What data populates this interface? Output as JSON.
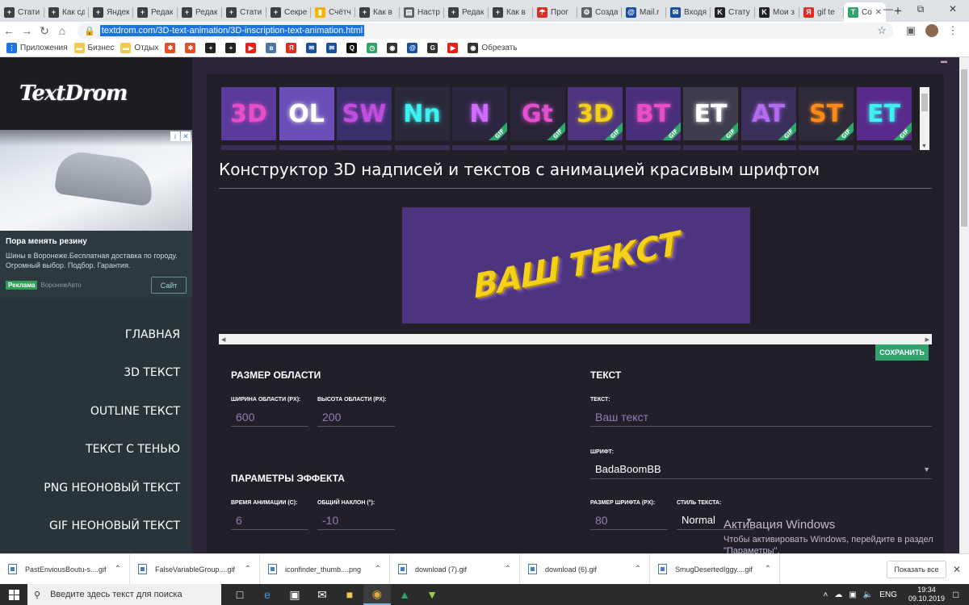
{
  "browser": {
    "tabs": [
      {
        "label": "Стати",
        "icon": "plus-icon",
        "color": "#3c4043"
      },
      {
        "label": "Как сд",
        "icon": "plus-icon",
        "color": "#3c4043"
      },
      {
        "label": "Яндек",
        "icon": "plus-icon",
        "color": "#3c4043"
      },
      {
        "label": "Редак",
        "icon": "plus-icon",
        "color": "#3c4043"
      },
      {
        "label": "Редак",
        "icon": "plus-icon",
        "color": "#3c4043"
      },
      {
        "label": "Стати",
        "icon": "plus-icon",
        "color": "#3c4043"
      },
      {
        "label": "Секре",
        "icon": "plus-icon",
        "color": "#3c4043"
      },
      {
        "label": "Счётч",
        "icon": "bar-icon",
        "color": "#f4b400"
      },
      {
        "label": "Как в",
        "icon": "plus-icon",
        "color": "#3c4043"
      },
      {
        "label": "Настр",
        "icon": "page-icon",
        "color": "#5f6368"
      },
      {
        "label": "Редак",
        "icon": "plus-icon",
        "color": "#3c4043"
      },
      {
        "label": "Как в",
        "icon": "plus-icon",
        "color": "#3c4043"
      },
      {
        "label": "Прог",
        "icon": "umbrella-icon",
        "color": "#d93025"
      },
      {
        "label": "Созда",
        "icon": "gear-icon",
        "color": "#5f6368"
      },
      {
        "label": "Mail.r",
        "icon": "at-icon",
        "color": "#1a4fa0"
      },
      {
        "label": "Входя",
        "icon": "mail-icon",
        "color": "#1a4fa0"
      },
      {
        "label": "Стату",
        "icon": "k-icon",
        "color": "#222"
      },
      {
        "label": "Мои з",
        "icon": "k-icon",
        "color": "#222"
      },
      {
        "label": "gif te",
        "icon": "yandex-icon",
        "color": "#d93025"
      },
      {
        "label": "Co",
        "icon": "td-icon",
        "color": "#2fa36b",
        "active": true
      }
    ],
    "new_tab": "+",
    "url": "textdrom.com/3D-text-animation/3D-inscription-text-animation.html",
    "bookmarks": [
      {
        "label": "Приложения",
        "icon": "apps-icon",
        "color": "#1a73e8"
      },
      {
        "label": "Бизнес",
        "icon": "folder-icon",
        "color": "#f2c94c"
      },
      {
        "label": "Отдых",
        "icon": "folder-icon",
        "color": "#f2c94c"
      },
      {
        "label": "",
        "icon": "joomla-icon",
        "color": "#e44d26"
      },
      {
        "label": "",
        "icon": "joomla-icon",
        "color": "#e44d26"
      },
      {
        "label": "",
        "icon": "plus-icon",
        "color": "#222"
      },
      {
        "label": "",
        "icon": "plus-icon",
        "color": "#222"
      },
      {
        "label": "",
        "icon": "youtube-icon",
        "color": "#e62117"
      },
      {
        "label": "",
        "icon": "vk-icon",
        "color": "#4a76a8"
      },
      {
        "label": "",
        "icon": "yandex-icon",
        "color": "#d93025"
      },
      {
        "label": "",
        "icon": "mail-icon",
        "color": "#1a4fa0"
      },
      {
        "label": "",
        "icon": "mail-icon",
        "color": "#1a4fa0"
      },
      {
        "label": "",
        "icon": "q-icon",
        "color": "#111"
      },
      {
        "label": "",
        "icon": "clock-icon",
        "color": "#2fa36b"
      },
      {
        "label": "",
        "icon": "chrome-icon",
        "color": "#333"
      },
      {
        "label": "",
        "icon": "at-icon",
        "color": "#1a4fa0"
      },
      {
        "label": "",
        "icon": "g-icon",
        "color": "#333"
      },
      {
        "label": "",
        "icon": "youtube-icon",
        "color": "#e62117"
      },
      {
        "label": "Обрезать",
        "icon": "chrome-icon",
        "color": "#333"
      }
    ]
  },
  "sidebar": {
    "logo": "TextDrom",
    "ad": {
      "title": "Пора менять резину",
      "body": "Шины в Воронеже.Бесплатная доставка по городу. Огромный выбор. Подбор. Гарантия.",
      "badge": "Реклама",
      "source": "ВоронежАвто",
      "button": "Сайт"
    },
    "menu": [
      "ГЛАВНАЯ",
      "3D ТЕКСТ",
      "OUTLINE ТЕКСТ",
      "ТЕКСТ С ТЕНЬЮ",
      "PNG НЕОНОВЫЙ ТЕКСТ",
      "GIF НЕОНОВЫЙ ТЕКСТ"
    ]
  },
  "gallery": [
    {
      "text": "3D",
      "color": "#e84ec8",
      "bg": "#5a3a9a",
      "gif": false
    },
    {
      "text": "OL",
      "color": "#ffffff",
      "bg": "#6b4fb8",
      "gif": false
    },
    {
      "text": "SW",
      "color": "#c04ee0",
      "bg": "#3a2f6a",
      "gif": false
    },
    {
      "text": "Nn",
      "color": "#3ff0f0",
      "bg": "#2a2a3a",
      "gif": false
    },
    {
      "text": "N",
      "color": "#d26bff",
      "bg": "#2d2640",
      "gif": true
    },
    {
      "text": "Gt",
      "color": "#e050d0",
      "bg": "#2a2438",
      "gif": true
    },
    {
      "text": "3D",
      "color": "#f5d01a",
      "bg": "#4c357e",
      "gif": true
    },
    {
      "text": "BT",
      "color": "#e84ec8",
      "bg": "#4a2f7a",
      "gif": true
    },
    {
      "text": "ET",
      "color": "#ffffff",
      "bg": "#3d3d4d",
      "gif": true
    },
    {
      "text": "AT",
      "color": "#b36bf0",
      "bg": "#3a2f5a",
      "gif": true
    },
    {
      "text": "ST",
      "color": "#ff8a1a",
      "bg": "#2e2a3a",
      "gif": true
    },
    {
      "text": "ET",
      "color": "#3ff0f0",
      "bg": "#5a2a8a",
      "gif": true
    }
  ],
  "title": "Конструктор 3D надписей и текстов с анимацией красивым шрифтом",
  "preview_text": "ВАШ ТЕКСТ",
  "save_button": "СОХРАНИТЬ",
  "area": {
    "heading": "РАЗМЕР ОБЛАСТИ",
    "width_label": "ШИРИНА ОБЛАСТИ (PX):",
    "width_value": "600",
    "height_label": "ВЫСОТА ОБЛАСТИ (PX):",
    "height_value": "200"
  },
  "effect": {
    "heading": "ПАРАМЕТРЫ ЭФФЕКТА",
    "time_label": "ВРЕМЯ АНИМАЦИИ (С):",
    "time_value": "6",
    "tilt_label": "ОБЩИЙ НАКЛОН (°):",
    "tilt_value": "-10"
  },
  "text": {
    "heading": "ТЕКСТ",
    "text_label": "ТЕКСТ:",
    "text_placeholder": "Ваш текст",
    "font_label": "ШРИФТ:",
    "font_value": "BadaBoomBB",
    "size_label": "РАЗМЕР ШРИФТА (PX):",
    "size_value": "80",
    "style_label": "СТИЛЬ ТЕКСТА:",
    "style_value": "Normal"
  },
  "windows_activation": {
    "title": "Активация Windows",
    "body": "Чтобы активировать Windows, перейдите в раздел \"Параметры\"."
  },
  "downloads": {
    "files": [
      "PastEnviousBoutu-s....gif",
      "FalseVariableGroup....gif",
      "iconfinder_thumb....png",
      "download (7).gif",
      "download (6).gif",
      "SmugDesertedIggy....gif"
    ],
    "show_all": "Показать все"
  },
  "taskbar": {
    "search_placeholder": "Введите здесь текст для поиска",
    "lang": "ENG",
    "time": "19:34",
    "date": "09.10.2019"
  }
}
